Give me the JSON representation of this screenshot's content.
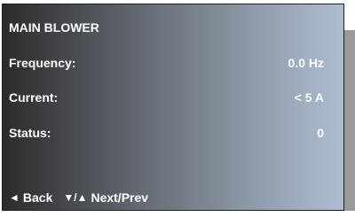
{
  "title": "MAIN BLOWER",
  "rows": [
    {
      "label": "Frequency:",
      "value": "0.0 Hz"
    },
    {
      "label": "Current:",
      "value": "< 5 A"
    },
    {
      "label": "Status:",
      "value": "0"
    }
  ],
  "nav": {
    "back_glyph": "◄",
    "back_label": "Back",
    "nextprev_glyph": "▼/▲",
    "nextprev_label": "Next/Prev"
  },
  "colors": {
    "text": "#ffffff",
    "gradient_left": "#2b2b2b",
    "gradient_right": "#aebdd2",
    "shadow": "#9a9a9a"
  }
}
